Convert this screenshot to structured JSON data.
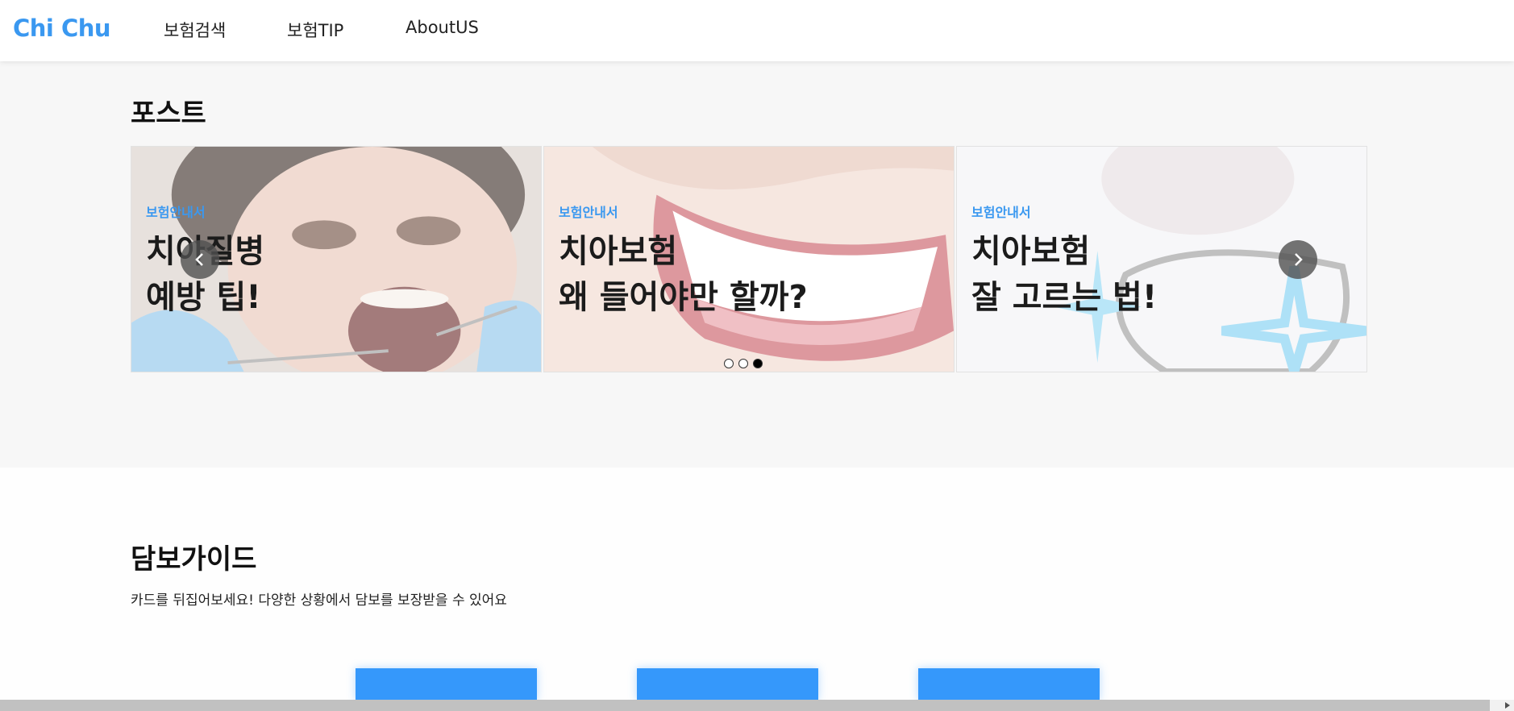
{
  "header": {
    "logo": "Chi Chu",
    "nav": [
      {
        "label": "보험검색"
      },
      {
        "label": "보험TIP"
      },
      {
        "label": "AboutUS"
      }
    ]
  },
  "posts": {
    "title": "포스트",
    "cards": [
      {
        "tag": "보험안내서",
        "line1": "치아질병",
        "line2": "예방 팁!",
        "image": "child-dental-exam"
      },
      {
        "tag": "보험안내서",
        "line1": "치아보험",
        "line2": "왜 들어야만 할까?",
        "image": "smiling-teeth"
      },
      {
        "tag": "보험안내서",
        "line1": "치아보험",
        "line2": "잘 고르는 법!",
        "image": "tooth-sparkle"
      }
    ],
    "prev_icon": "chevron-left-icon",
    "next_icon": "chevron-right-icon",
    "pagination": {
      "count": 3,
      "active_index": 2
    }
  },
  "guide": {
    "title": "담보가이드",
    "subtitle": "카드를 뒤집어보세요! 다양한 상황에서 담보를 보장받을 수 있어요"
  },
  "colors": {
    "brand": "#3a98f0",
    "card_blue": "#3598fb",
    "section_bg": "#f7f7f7"
  }
}
